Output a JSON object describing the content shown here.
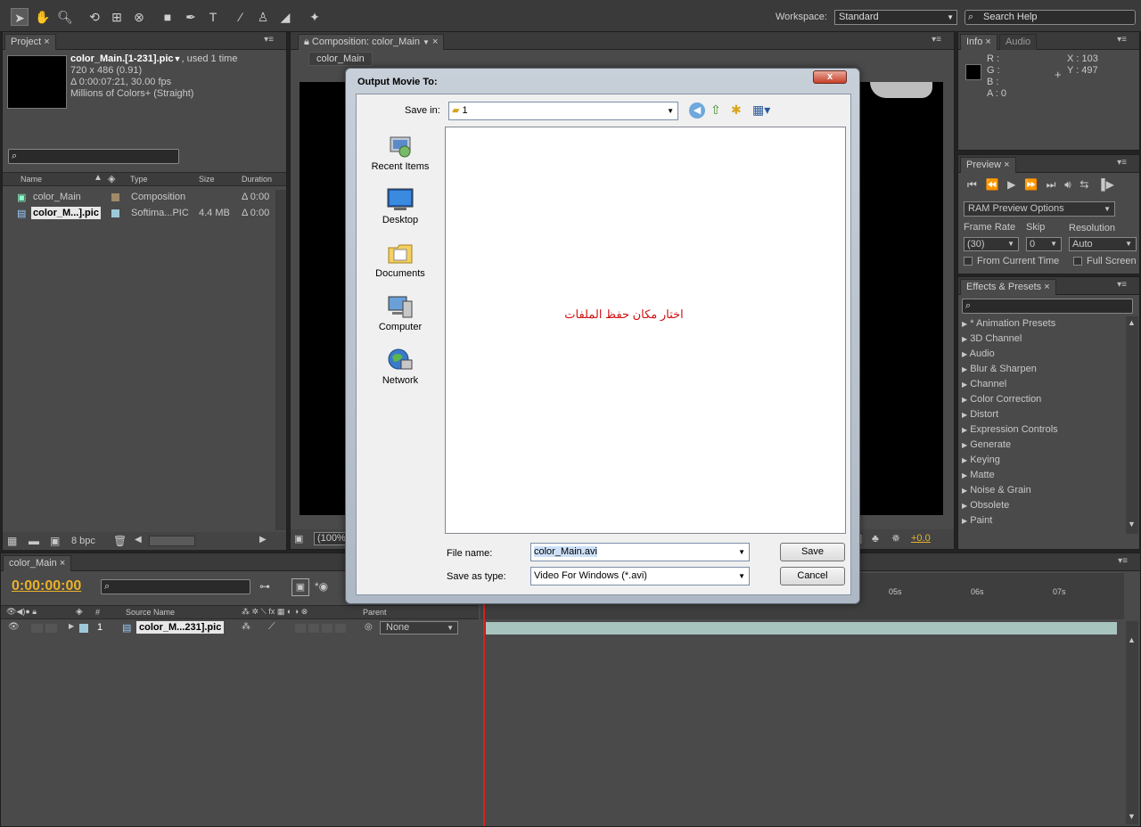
{
  "toolbar": {
    "workspace_label": "Workspace:",
    "workspace_value": "Standard",
    "search_placeholder": "Search Help",
    "tools": [
      "selection-tool-icon",
      "hand-tool-icon",
      "zoom-tool-icon",
      "rotation-tool-icon",
      "camera-tool-icon",
      "pan-behind-tool-icon",
      "rectangle-tool-icon",
      "pen-tool-icon",
      "type-tool-icon",
      "brush-tool-icon",
      "clone-stamp-tool-icon",
      "eraser-tool-icon",
      "puppet-pin-tool-icon"
    ]
  },
  "project": {
    "tab_label": "Project",
    "file_name": "color_Main.[1-231].pic",
    "used_text": ", used 1 time",
    "dimensions": "720 x 486 (0.91)",
    "duration_fps": "Δ 0:00:07:21, 30.00 fps",
    "color_info": "Millions of Colors+ (Straight)",
    "columns": {
      "name": "Name",
      "type": "Type",
      "size": "Size",
      "duration": "Duration"
    },
    "items": [
      {
        "name": "color_Main",
        "type": "Composition",
        "size": "",
        "duration": "Δ 0:00"
      },
      {
        "name": "color_M...].pic",
        "type": "Softima...PIC",
        "size": "4.4 MB",
        "duration": "Δ 0:00"
      }
    ],
    "bpc": "8 bpc"
  },
  "composition": {
    "tab_label": "Composition: color_Main",
    "crumb_label": "color_Main",
    "zoom": "(100%)",
    "exposure": "+0.0"
  },
  "info": {
    "tab_label": "Info",
    "tab2_label": "Audio",
    "r": "R :",
    "g": "G :",
    "b": "B :",
    "a": "A : 0",
    "x": "X : 103",
    "y": "Y : 497"
  },
  "preview": {
    "tab_label": "Preview",
    "ram_options": "RAM Preview Options",
    "frame_rate_label": "Frame Rate",
    "skip_label": "Skip",
    "resolution_label": "Resolution",
    "frame_rate_value": "(30)",
    "skip_value": "0",
    "resolution_value": "Auto",
    "from_current_time": "From Current Time",
    "full_screen": "Full Screen"
  },
  "effects": {
    "tab_label": "Effects & Presets",
    "items": [
      "* Animation Presets",
      "3D Channel",
      "Audio",
      "Blur & Sharpen",
      "Channel",
      "Color Correction",
      "Distort",
      "Expression Controls",
      "Generate",
      "Keying",
      "Matte",
      "Noise & Grain",
      "Obsolete",
      "Paint"
    ]
  },
  "timeline": {
    "tab_label": "color_Main",
    "timecode": "0:00:00:00",
    "source_name_col": "Source Name",
    "parent_col": "Parent",
    "layer_number": "1",
    "layer_name": "color_M...231].pic",
    "parent_value": "None",
    "ruler_marks": [
      "05s",
      "06s",
      "07s"
    ]
  },
  "dialog": {
    "title": "Output Movie To:",
    "save_in_label": "Save in:",
    "save_in_value": "1",
    "places": [
      "Recent Items",
      "Desktop",
      "Documents",
      "Computer",
      "Network"
    ],
    "annotation": "اختار مكان حفظ الملفات",
    "file_name_label": "File name:",
    "file_name_value": "color_Main.avi",
    "save_as_type_label": "Save as type:",
    "save_as_type_value": "Video For Windows (*.avi)",
    "save_button": "Save",
    "cancel_button": "Cancel",
    "annotation_color": "#d01010"
  }
}
